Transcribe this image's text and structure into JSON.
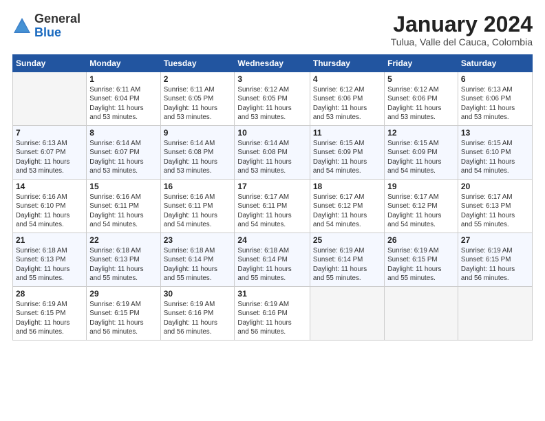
{
  "header": {
    "logo_general": "General",
    "logo_blue": "Blue",
    "month_title": "January 2024",
    "subtitle": "Tulua, Valle del Cauca, Colombia"
  },
  "weekdays": [
    "Sunday",
    "Monday",
    "Tuesday",
    "Wednesday",
    "Thursday",
    "Friday",
    "Saturday"
  ],
  "weeks": [
    [
      {
        "day": "",
        "info": ""
      },
      {
        "day": "1",
        "info": "Sunrise: 6:11 AM\nSunset: 6:04 PM\nDaylight: 11 hours\nand 53 minutes."
      },
      {
        "day": "2",
        "info": "Sunrise: 6:11 AM\nSunset: 6:05 PM\nDaylight: 11 hours\nand 53 minutes."
      },
      {
        "day": "3",
        "info": "Sunrise: 6:12 AM\nSunset: 6:05 PM\nDaylight: 11 hours\nand 53 minutes."
      },
      {
        "day": "4",
        "info": "Sunrise: 6:12 AM\nSunset: 6:06 PM\nDaylight: 11 hours\nand 53 minutes."
      },
      {
        "day": "5",
        "info": "Sunrise: 6:12 AM\nSunset: 6:06 PM\nDaylight: 11 hours\nand 53 minutes."
      },
      {
        "day": "6",
        "info": "Sunrise: 6:13 AM\nSunset: 6:06 PM\nDaylight: 11 hours\nand 53 minutes."
      }
    ],
    [
      {
        "day": "7",
        "info": "Sunrise: 6:13 AM\nSunset: 6:07 PM\nDaylight: 11 hours\nand 53 minutes."
      },
      {
        "day": "8",
        "info": "Sunrise: 6:14 AM\nSunset: 6:07 PM\nDaylight: 11 hours\nand 53 minutes."
      },
      {
        "day": "9",
        "info": "Sunrise: 6:14 AM\nSunset: 6:08 PM\nDaylight: 11 hours\nand 53 minutes."
      },
      {
        "day": "10",
        "info": "Sunrise: 6:14 AM\nSunset: 6:08 PM\nDaylight: 11 hours\nand 53 minutes."
      },
      {
        "day": "11",
        "info": "Sunrise: 6:15 AM\nSunset: 6:09 PM\nDaylight: 11 hours\nand 54 minutes."
      },
      {
        "day": "12",
        "info": "Sunrise: 6:15 AM\nSunset: 6:09 PM\nDaylight: 11 hours\nand 54 minutes."
      },
      {
        "day": "13",
        "info": "Sunrise: 6:15 AM\nSunset: 6:10 PM\nDaylight: 11 hours\nand 54 minutes."
      }
    ],
    [
      {
        "day": "14",
        "info": "Sunrise: 6:16 AM\nSunset: 6:10 PM\nDaylight: 11 hours\nand 54 minutes."
      },
      {
        "day": "15",
        "info": "Sunrise: 6:16 AM\nSunset: 6:11 PM\nDaylight: 11 hours\nand 54 minutes."
      },
      {
        "day": "16",
        "info": "Sunrise: 6:16 AM\nSunset: 6:11 PM\nDaylight: 11 hours\nand 54 minutes."
      },
      {
        "day": "17",
        "info": "Sunrise: 6:17 AM\nSunset: 6:11 PM\nDaylight: 11 hours\nand 54 minutes."
      },
      {
        "day": "18",
        "info": "Sunrise: 6:17 AM\nSunset: 6:12 PM\nDaylight: 11 hours\nand 54 minutes."
      },
      {
        "day": "19",
        "info": "Sunrise: 6:17 AM\nSunset: 6:12 PM\nDaylight: 11 hours\nand 54 minutes."
      },
      {
        "day": "20",
        "info": "Sunrise: 6:17 AM\nSunset: 6:13 PM\nDaylight: 11 hours\nand 55 minutes."
      }
    ],
    [
      {
        "day": "21",
        "info": "Sunrise: 6:18 AM\nSunset: 6:13 PM\nDaylight: 11 hours\nand 55 minutes."
      },
      {
        "day": "22",
        "info": "Sunrise: 6:18 AM\nSunset: 6:13 PM\nDaylight: 11 hours\nand 55 minutes."
      },
      {
        "day": "23",
        "info": "Sunrise: 6:18 AM\nSunset: 6:14 PM\nDaylight: 11 hours\nand 55 minutes."
      },
      {
        "day": "24",
        "info": "Sunrise: 6:18 AM\nSunset: 6:14 PM\nDaylight: 11 hours\nand 55 minutes."
      },
      {
        "day": "25",
        "info": "Sunrise: 6:19 AM\nSunset: 6:14 PM\nDaylight: 11 hours\nand 55 minutes."
      },
      {
        "day": "26",
        "info": "Sunrise: 6:19 AM\nSunset: 6:15 PM\nDaylight: 11 hours\nand 55 minutes."
      },
      {
        "day": "27",
        "info": "Sunrise: 6:19 AM\nSunset: 6:15 PM\nDaylight: 11 hours\nand 56 minutes."
      }
    ],
    [
      {
        "day": "28",
        "info": "Sunrise: 6:19 AM\nSunset: 6:15 PM\nDaylight: 11 hours\nand 56 minutes."
      },
      {
        "day": "29",
        "info": "Sunrise: 6:19 AM\nSunset: 6:15 PM\nDaylight: 11 hours\nand 56 minutes."
      },
      {
        "day": "30",
        "info": "Sunrise: 6:19 AM\nSunset: 6:16 PM\nDaylight: 11 hours\nand 56 minutes."
      },
      {
        "day": "31",
        "info": "Sunrise: 6:19 AM\nSunset: 6:16 PM\nDaylight: 11 hours\nand 56 minutes."
      },
      {
        "day": "",
        "info": ""
      },
      {
        "day": "",
        "info": ""
      },
      {
        "day": "",
        "info": ""
      }
    ]
  ]
}
